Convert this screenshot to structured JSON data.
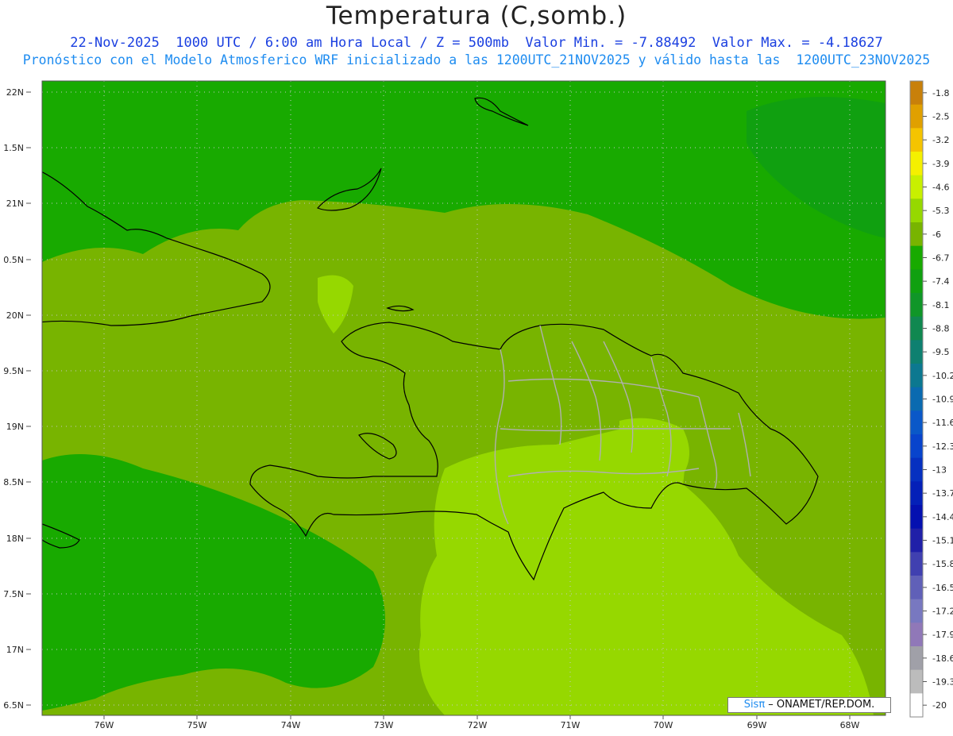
{
  "title": "Temperatura (C,somb.)",
  "subtitle_line1": "22-Nov-2025  1000 UTC / 6:00 am Hora Local / Z = 500mb  Valor Min. = -7.88492  Valor Max. = -4.18627",
  "subtitle_line2": "Pronóstico con el Modelo Atmosferico WRF inicializado a las 1200UTC_21NOV2025 y válido hasta las  1200UTC_23NOV2025",
  "credit": {
    "brand": "Sisπ",
    "text": " – ONAMET/REP.DOM."
  },
  "latitude_labels": [
    "22N",
    "1.5N",
    "21N",
    "0.5N",
    "20N",
    "9.5N",
    "19N",
    "8.5N",
    "18N",
    "7.5N",
    "17N",
    "6.5N"
  ],
  "longitude_labels": [
    "76W",
    "75W",
    "74W",
    "73W",
    "72W",
    "71W",
    "70W",
    "69W",
    "68W"
  ],
  "colorbar": {
    "labels": [
      "-1.8",
      "-2.5",
      "-3.2",
      "-3.9",
      "-4.6",
      "-5.3",
      "-6",
      "-6.7",
      "-7.4",
      "-8.1",
      "-8.8",
      "-9.5",
      "-10.2",
      "-10.9",
      "-11.6",
      "-12.3",
      "-13",
      "-13.7",
      "-14.4",
      "-15.1",
      "-15.8",
      "-16.5",
      "-17.2",
      "-17.9",
      "-18.6",
      "-19.3",
      "-20"
    ],
    "colors": [
      "#c8800a",
      "#e0a000",
      "#f5c400",
      "#f5f000",
      "#c8f000",
      "#96d800",
      "#78b400",
      "#18aa00",
      "#10a010",
      "#109628",
      "#108850",
      "#0e8070",
      "#0c7890",
      "#0a6ab0",
      "#0a58c8",
      "#0844cc",
      "#0630c0",
      "#0420b8",
      "#0410b0",
      "#2020a8",
      "#4040b0",
      "#6060b8",
      "#7878c0",
      "#9078b8",
      "#a0a0a8",
      "#bcbcbc",
      "#ffffff"
    ]
  },
  "field_colors": {
    "cold": "#18aa00",
    "mid": "#78b400",
    "warm": "#96d800",
    "coast": "#000000",
    "provinces": "#b0b0b0"
  }
}
